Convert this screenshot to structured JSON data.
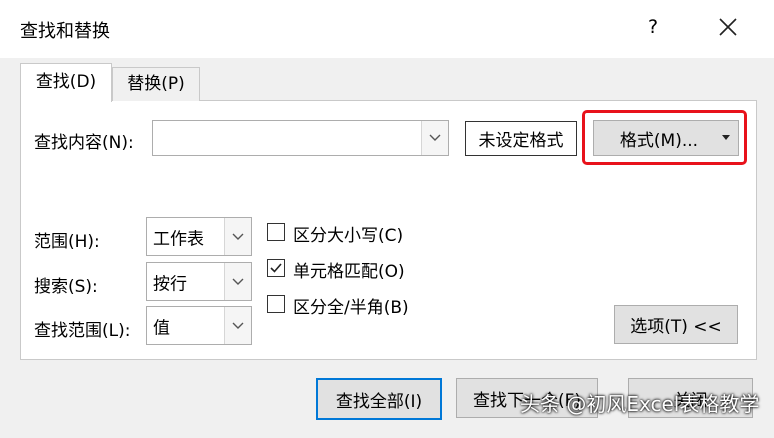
{
  "window": {
    "title": "查找和替换",
    "help_label": "?"
  },
  "tabs": [
    {
      "label": "查找(D)",
      "active": true
    },
    {
      "label": "替换(P)",
      "active": false
    }
  ],
  "find": {
    "label": "查找内容(N):",
    "value": "",
    "format_status": "未设定格式",
    "format_button": "格式(M)..."
  },
  "options": {
    "scope_label": "范围(H):",
    "scope_value": "工作表",
    "search_label": "搜索(S):",
    "search_value": "按行",
    "lookin_label": "查找范围(L):",
    "lookin_value": "值",
    "match_case": {
      "label": "区分大小写(C)",
      "checked": false
    },
    "match_entire": {
      "label": "单元格匹配(O)",
      "checked": true
    },
    "match_byte": {
      "label": "区分全/半角(B)",
      "checked": false
    },
    "options_button": "选项(T) <<"
  },
  "footer": {
    "find_all": "查找全部(I)",
    "find_next": "查找下一个(F)",
    "close": "关闭"
  },
  "watermark": "头条 @初风Excel表格教学",
  "colors": {
    "highlight": "#e8121b",
    "focus": "#0078d7"
  }
}
